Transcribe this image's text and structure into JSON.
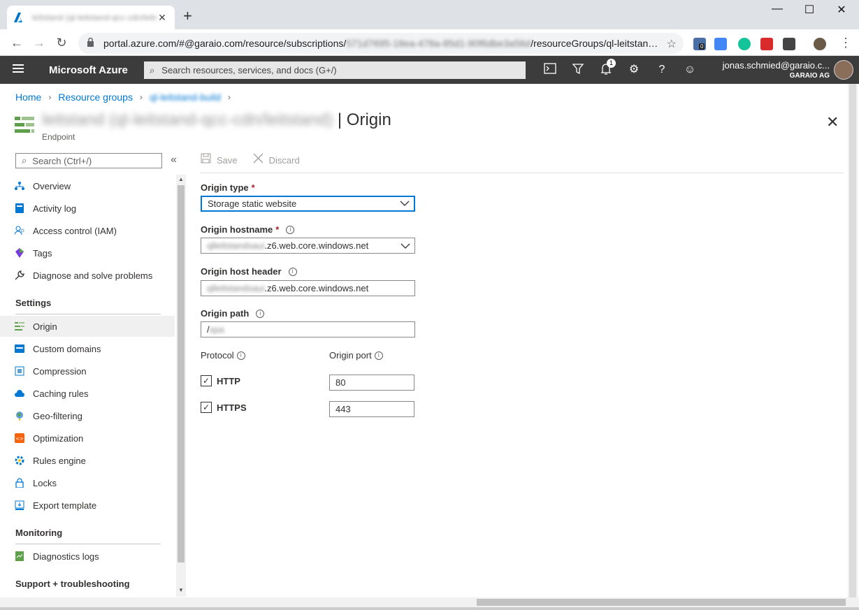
{
  "browser": {
    "tab_title": "leitstand (ql-leitstand-qcc-cdn/leitstand) | Origin - Microsoft Azure",
    "tab_close": "✕",
    "new_tab": "+",
    "window_minimize": "—",
    "window_maximize": "☐",
    "window_close": "✕",
    "url_prefix": "portal.azure.com/#@garaio.com/resource/subscriptions/",
    "url_blurred": "571d7695-18ea-478a-85d1-90f6dbe3a56d",
    "url_suffix": "/resourceGroups/ql-leitstan…",
    "ext_badge": "0"
  },
  "azure": {
    "brand": "Microsoft Azure",
    "search_placeholder": "Search resources, services, and docs (G+/)",
    "notifications_count": "1",
    "user_email": "jonas.schmied@garaio.c...",
    "user_org": "GARAIO AG"
  },
  "breadcrumb": {
    "home": "Home",
    "resource_groups": "Resource groups",
    "group_blurred": "ql-leitstand-build"
  },
  "page": {
    "title_blurred": "leitstand (ql-leitstand-qcc-cdn/leitstand)",
    "title": "| Origin",
    "subtitle": "Endpoint"
  },
  "nav": {
    "search_placeholder": "Search (Ctrl+/)",
    "collapse": "«",
    "items": [
      {
        "label": "Overview",
        "icon": "overview-icon"
      },
      {
        "label": "Activity log",
        "icon": "activity-log-icon"
      },
      {
        "label": "Access control (IAM)",
        "icon": "iam-icon"
      },
      {
        "label": "Tags",
        "icon": "tag-icon"
      },
      {
        "label": "Diagnose and solve problems",
        "icon": "wrench-icon"
      }
    ],
    "settings_header": "Settings",
    "settings_items": [
      {
        "label": "Origin",
        "icon": "origin-icon"
      },
      {
        "label": "Custom domains",
        "icon": "custom-domains-icon"
      },
      {
        "label": "Compression",
        "icon": "compression-icon"
      },
      {
        "label": "Caching rules",
        "icon": "caching-rules-icon"
      },
      {
        "label": "Geo-filtering",
        "icon": "geo-filtering-icon"
      },
      {
        "label": "Optimization",
        "icon": "optimization-icon"
      },
      {
        "label": "Rules engine",
        "icon": "rules-engine-icon"
      },
      {
        "label": "Locks",
        "icon": "lock-icon"
      },
      {
        "label": "Export template",
        "icon": "export-template-icon"
      }
    ],
    "monitoring_header": "Monitoring",
    "monitoring_items": [
      {
        "label": "Diagnostics logs",
        "icon": "diagnostics-logs-icon"
      }
    ],
    "support_header": "Support + troubleshooting"
  },
  "commands": {
    "save": "Save",
    "discard": "Discard"
  },
  "form": {
    "origin_type_label": "Origin type",
    "origin_type_value": "Storage static website",
    "origin_hostname_label": "Origin hostname",
    "origin_hostname_blurred": "qlleitstandsaui",
    "origin_hostname_suffix": ".z6.web.core.windows.net",
    "origin_host_header_label": "Origin host header",
    "origin_host_header_blurred": "qlleitstandsaui",
    "origin_host_header_suffix": ".z6.web.core.windows.net",
    "origin_path_label": "Origin path",
    "origin_path_prefix": "/",
    "origin_path_blurred": "spa",
    "protocol_label": "Protocol",
    "origin_port_label": "Origin port",
    "http_label": "HTTP",
    "https_label": "HTTPS",
    "http_checked": true,
    "https_checked": true,
    "http_port": "80",
    "https_port": "443",
    "required_marker": "*",
    "info_glyph": "i"
  },
  "colors": {
    "accent": "#0078d4",
    "header_bg": "#3c3c3c",
    "required": "#a4262c"
  }
}
